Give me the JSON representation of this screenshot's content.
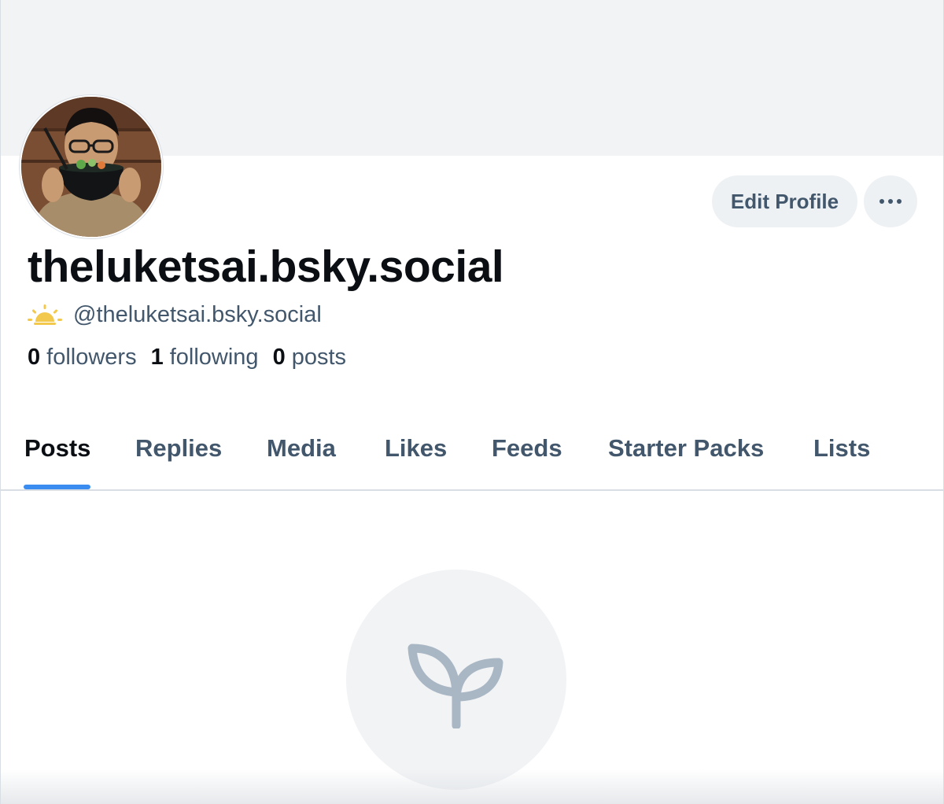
{
  "profile": {
    "display_name": "theluketsai.bsky.social",
    "handle": "@theluketsai.bsky.social",
    "handle_icon": "sunrise-icon",
    "avatar_alt": "avatar"
  },
  "actions": {
    "edit_profile_label": "Edit Profile",
    "more_icon": "ellipsis-icon"
  },
  "stats": {
    "followers_count": "0",
    "followers_label": "followers",
    "following_count": "1",
    "following_label": "following",
    "posts_count": "0",
    "posts_label": "posts"
  },
  "tabs": [
    {
      "label": "Posts",
      "active": true
    },
    {
      "label": "Replies",
      "active": false
    },
    {
      "label": "Media",
      "active": false
    },
    {
      "label": "Likes",
      "active": false
    },
    {
      "label": "Feeds",
      "active": false
    },
    {
      "label": "Starter Packs",
      "active": false
    },
    {
      "label": "Lists",
      "active": false
    }
  ],
  "empty_state": {
    "icon": "sprout-icon"
  },
  "colors": {
    "accent": "#3b8cf0",
    "text_primary": "#0b0f14",
    "text_secondary": "#42576c",
    "banner": "#f1f3f5",
    "icon_muted": "#a9b6c4",
    "sun": "#f2c94c"
  }
}
